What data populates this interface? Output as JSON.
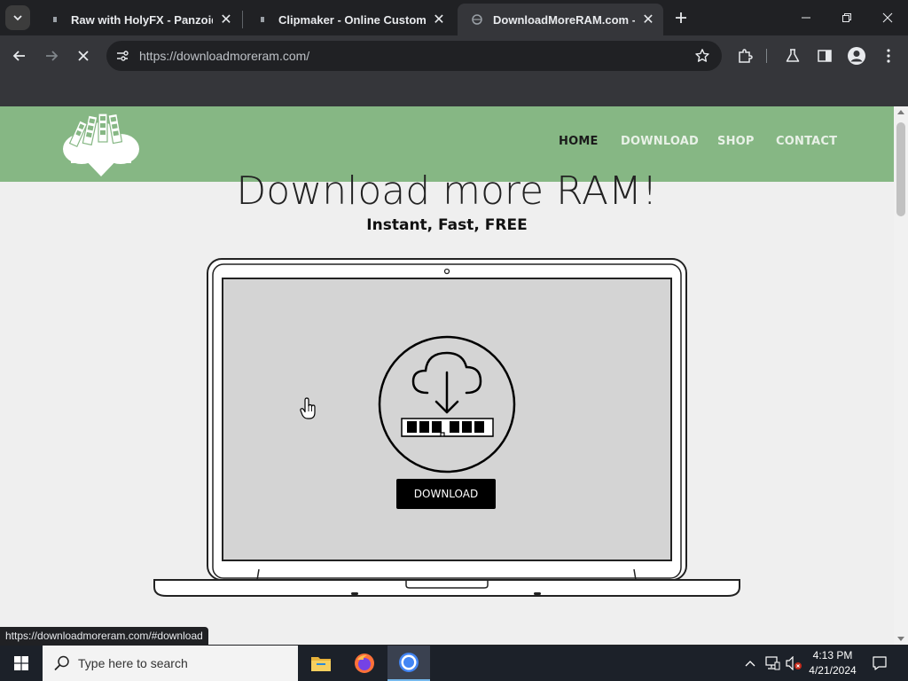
{
  "tabs": [
    {
      "title": "Raw with HolyFX - Panzoid",
      "active": false
    },
    {
      "title": "Clipmaker - Online Custom Intro",
      "active": false
    },
    {
      "title": "DownloadMoreRAM.com - CloudRAM",
      "active": true
    }
  ],
  "toolbar": {
    "url": "https://downloadmoreram.com/"
  },
  "site": {
    "nav": [
      "HOME",
      "DOWNLOAD",
      "SHOP",
      "CONTACT"
    ],
    "current_nav": "HOME",
    "hero_title": "Download more RAM!",
    "hero_subtitle": "Instant, Fast, FREE",
    "download_button": "DOWNLOAD",
    "header_color": "#86b784"
  },
  "status_bar": {
    "link_url": "https://downloadmoreram.com/#download"
  },
  "taskbar": {
    "search_placeholder": "Type here to search",
    "time": "4:13 PM",
    "date": "4/21/2024",
    "apps": [
      "file-explorer",
      "firefox",
      "chrome"
    ]
  }
}
